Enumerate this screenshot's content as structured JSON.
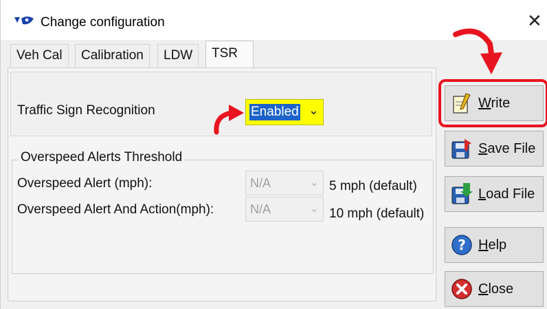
{
  "window": {
    "title": "Change configuration",
    "close_glyph": "✕"
  },
  "tabs": [
    {
      "label": "Veh Cal",
      "active": false
    },
    {
      "label": "Calibration",
      "active": false
    },
    {
      "label": "LDW",
      "active": false
    },
    {
      "label": "TSR",
      "active": true
    }
  ],
  "tsr": {
    "label": "Traffic Sign Recognition",
    "value": "Enabled",
    "arrow": "⌄"
  },
  "overspeed": {
    "group_title": "Overspeed Alerts Threshold",
    "alert": {
      "label": "Overspeed Alert (mph):",
      "value": "N/A",
      "default_note": "5 mph (default)"
    },
    "alert_action": {
      "label": "Overspeed Alert And Action(mph):",
      "value": "N/A",
      "default_note": "10 mph (default)"
    },
    "arrow": "⌄"
  },
  "buttons": {
    "write": {
      "first": "W",
      "rest": "rite"
    },
    "save_file": {
      "first": "S",
      "rest": "ave File"
    },
    "load_file": {
      "first": "L",
      "rest": "oad File"
    },
    "help": {
      "first": "H",
      "rest": "elp"
    },
    "close": {
      "first": "C",
      "rest": "lose"
    }
  },
  "icons": {
    "app": "app-logo-icon",
    "write": "notepad-pencil-icon",
    "save": "save-disk-icon",
    "load": "load-disk-icon",
    "help": "help-question-icon",
    "close": "close-x-icon"
  },
  "colors": {
    "highlight_red": "#e8141f",
    "dropdown_yellow": "#ffff00",
    "selection_blue": "#1e64c8"
  }
}
